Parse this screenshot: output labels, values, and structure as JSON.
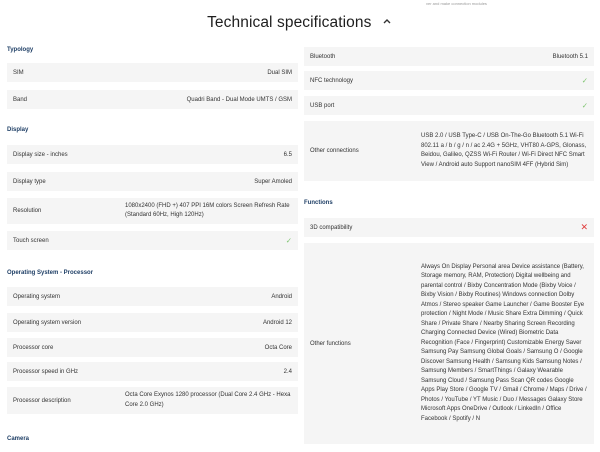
{
  "promo_text": "ver and make connection modules",
  "page_title": "Technical specifications",
  "icons": {
    "collapse": "chevron-up-icon",
    "yes": "check-icon",
    "no": "x-icon"
  },
  "colors": {
    "section": "#1f3f66",
    "row_bg": "#f5f5f5",
    "check": "#7dc46e",
    "cross": "#e03b3b"
  },
  "left": {
    "typology": {
      "title": "Typology",
      "rows": [
        {
          "label": "SIM",
          "value": "Dual SIM"
        },
        {
          "label": "Band",
          "value": "Quadri Band - Dual Mode UMTS / GSM"
        }
      ]
    },
    "display": {
      "title": "Display",
      "rows": [
        {
          "label": "Display size - inches",
          "value": "6.5"
        },
        {
          "label": "Display type",
          "value": "Super Amoled"
        },
        {
          "label": "Resolution",
          "value": "1080x2400 (FHD +) 407 PPI 16M colors Screen Refresh Rate (Standard 60Hz, High 120Hz)"
        },
        {
          "label": "Touch screen",
          "value": "yes"
        }
      ]
    },
    "os": {
      "title": "Operating System - Processor",
      "rows": [
        {
          "label": "Operating system",
          "value": "Android"
        },
        {
          "label": "Operating system version",
          "value": "Android 12"
        },
        {
          "label": "Processor core",
          "value": "Octa Core"
        },
        {
          "label": "Processor speed in GHz",
          "value": "2.4"
        },
        {
          "label": "Processor description",
          "value": "Octa Core Exynos 1280 processor (Dual Core 2.4 GHz - Hexa Core 2.0 GHz)"
        }
      ]
    },
    "camera": {
      "title": "Camera"
    }
  },
  "right": {
    "connectivity": {
      "rows": [
        {
          "label": "Bluetooth",
          "value": "Bluetooth 5.1"
        },
        {
          "label": "NFC technology",
          "value": "yes"
        },
        {
          "label": "USB port",
          "value": "yes"
        },
        {
          "label": "Other connections",
          "value": "USB 2.0 / USB Type-C / USB On-The-Go Bluetooth 5.1 Wi-Fi 802.11 a / b / g / n / ac 2.4G + 5GHz, VHT80 A-GPS, Glonass, Beidou, Galileo, QZSS Wi-Fi Router / Wi-Fi Direct NFC Smart View / Android auto Support nanoSIM 4FF (Hybrid Sim)"
        }
      ]
    },
    "functions": {
      "title": "Functions",
      "rows": [
        {
          "label": "3D compatibility",
          "value": "no"
        },
        {
          "label": "Other functions",
          "value": "Always On Display Personal area Device assistance (Battery, Storage memory, RAM, Protection) Digital wellbeing and parental control / Bixby Concentration Mode (Bixby Voice / Bixby Vision / Bixby Routines) Windows connection Dolby Atmos / Stereo speaker Game Launcher / Game Booster Eye protection / Night Mode / Music Share Extra Dimming / Quick Share / Private Share / Nearby Sharing Screen Recording Charging Connected Device (Wired) Biometric Data Recognition (Face / Fingerprint) Customizable Energy Saver Samsung Pay Samsung Global Goals / Samsung O / Google Discover Samsung Health / Samsung Kids Samsung Notes / Samsung Members / SmartThings / Galaxy Wearable Samsung Cloud / Samsung Pass Scan QR codes Google Apps Play Store / Google TV / Gmail / Chrome / Maps / Drive / Photos / YouTube / YT Music / Duo / Messages Galaxy Store Microsoft Apps OneDrive / Outlook / LinkedIn / Office Facebook / Spotify / N"
        }
      ]
    }
  }
}
